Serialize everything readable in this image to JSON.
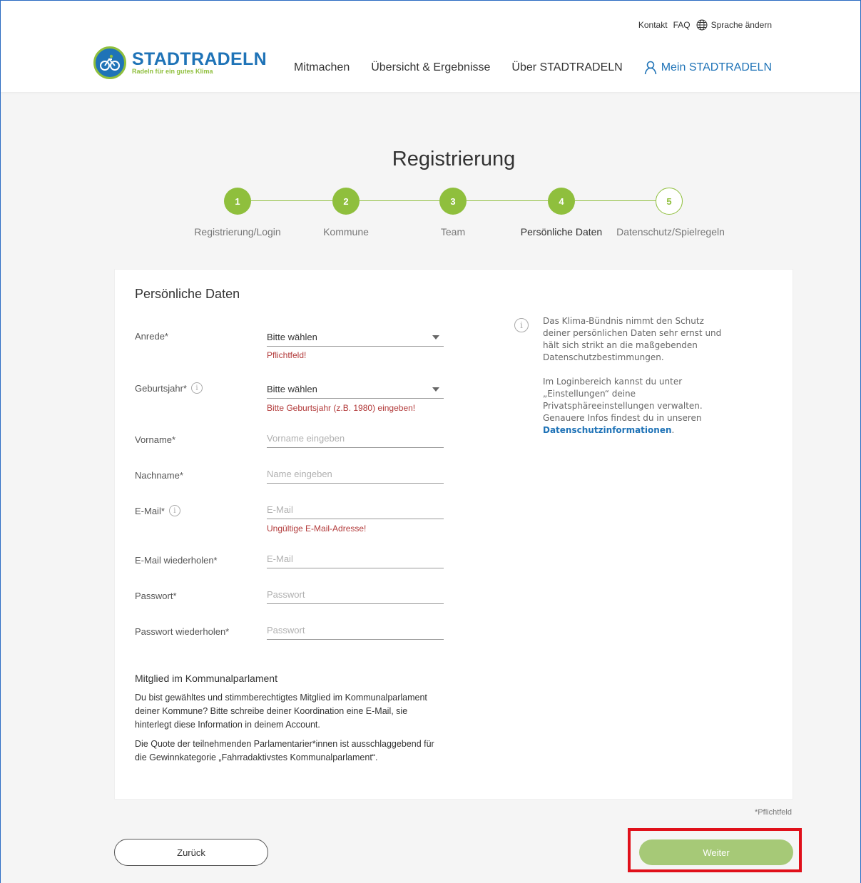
{
  "header": {
    "logo_title": "STADTRADELN",
    "logo_subtitle": "Radeln für ein gutes Klima",
    "meta": {
      "contact": "Kontakt",
      "faq": "FAQ",
      "language": "Sprache ändern"
    },
    "nav": [
      "Mitmachen",
      "Übersicht & Ergebnisse",
      "Über STADTRADELN"
    ],
    "nav_mine": "Mein STADTRADELN"
  },
  "page_title": "Registrierung",
  "steps": [
    {
      "number": "1",
      "label": "Registrierung/Login"
    },
    {
      "number": "2",
      "label": "Kommune"
    },
    {
      "number": "3",
      "label": "Team"
    },
    {
      "number": "4",
      "label": "Persönliche Daten"
    },
    {
      "number": "5",
      "label": "Datenschutz/Spielregeln"
    }
  ],
  "form": {
    "heading": "Persönliche Daten",
    "anrede": {
      "label": "Anrede*",
      "value": "Bitte wählen",
      "error": "Pflichtfeld!"
    },
    "geburtsjahr": {
      "label": "Geburtsjahr*",
      "value": "Bitte wählen",
      "error": "Bitte Geburtsjahr (z.B. 1980) eingeben!"
    },
    "vorname": {
      "label": "Vorname*",
      "placeholder": "Vorname eingeben"
    },
    "nachname": {
      "label": "Nachname*",
      "placeholder": "Name eingeben"
    },
    "email": {
      "label": "E-Mail*",
      "placeholder": "E-Mail",
      "error": "Ungültige E-Mail-Adresse!"
    },
    "email_repeat": {
      "label": "E-Mail wiederholen*",
      "placeholder": "E-Mail"
    },
    "password": {
      "label": "Passwort*",
      "placeholder": "Passwort"
    },
    "password_repeat": {
      "label": "Passwort wiederholen*",
      "placeholder": "Passwort"
    }
  },
  "side_info": {
    "p1": "Das Klima-Bündnis nimmt den Schutz deiner persönlichen Daten sehr ernst und hält sich strikt an die maßgebenden Datenschutzbestimmungen.",
    "p2": "Im Loginbereich kannst du unter „Einstellungen“ deine Privatsphäreeinstellungen verwalten. Genauere Infos findest du in unseren",
    "link": "Datenschutzinformationen",
    "link_suffix": "."
  },
  "kommunalparlament": {
    "heading": "Mitglied im Kommunalparlament",
    "p1": "Du bist gewähltes und stimmberechtigtes Mitglied im Kommunalparlament deiner Kommune? Bitte schreibe deiner Koordination eine E-Mail, sie hinterlegt diese Information in deinem Account.",
    "p2": "Die Quote der teilnehmenden Parlamentarier*innen ist ausschlaggebend für die Gewinnkategorie „Fahrradaktivstes Kommunalparlament“."
  },
  "required_note": "*Pflichtfeld",
  "buttons": {
    "back": "Zurück",
    "next": "Weiter"
  }
}
